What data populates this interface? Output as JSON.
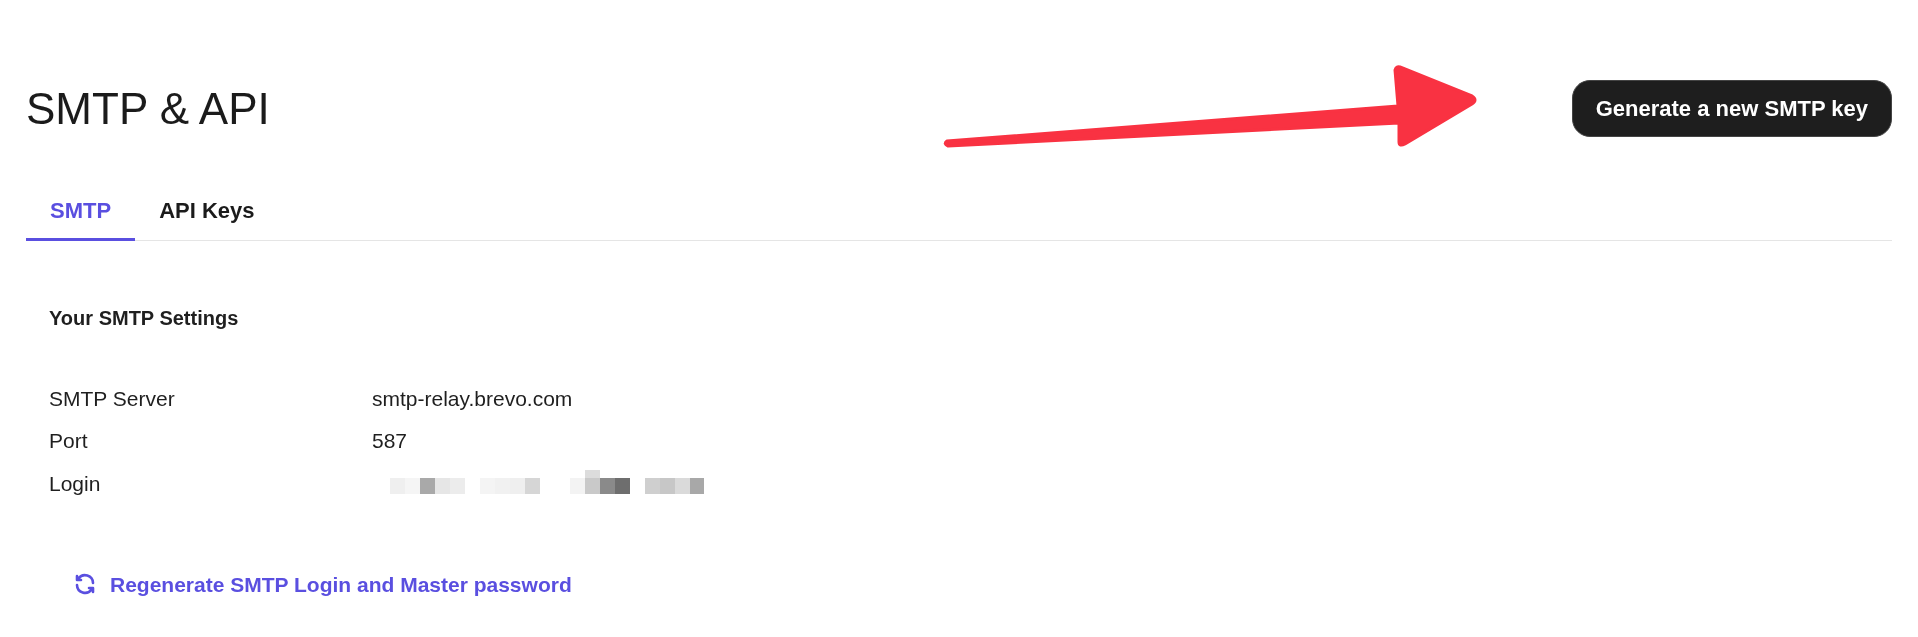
{
  "title": "SMTP & API",
  "primary_button": "Generate a new SMTP key",
  "tabs": [
    {
      "label": "SMTP",
      "selected": true
    },
    {
      "label": "API Keys",
      "selected": false
    }
  ],
  "settings": {
    "heading": "Your SMTP Settings",
    "rows": [
      {
        "kind": "text",
        "label": "SMTP Server",
        "value": "smtp-relay.brevo.com"
      },
      {
        "kind": "text",
        "label": "Port",
        "value": "587"
      },
      {
        "kind": "redacted",
        "label": "Login"
      }
    ]
  },
  "regenerate_link": "Regenerate SMTP Login and Master password"
}
